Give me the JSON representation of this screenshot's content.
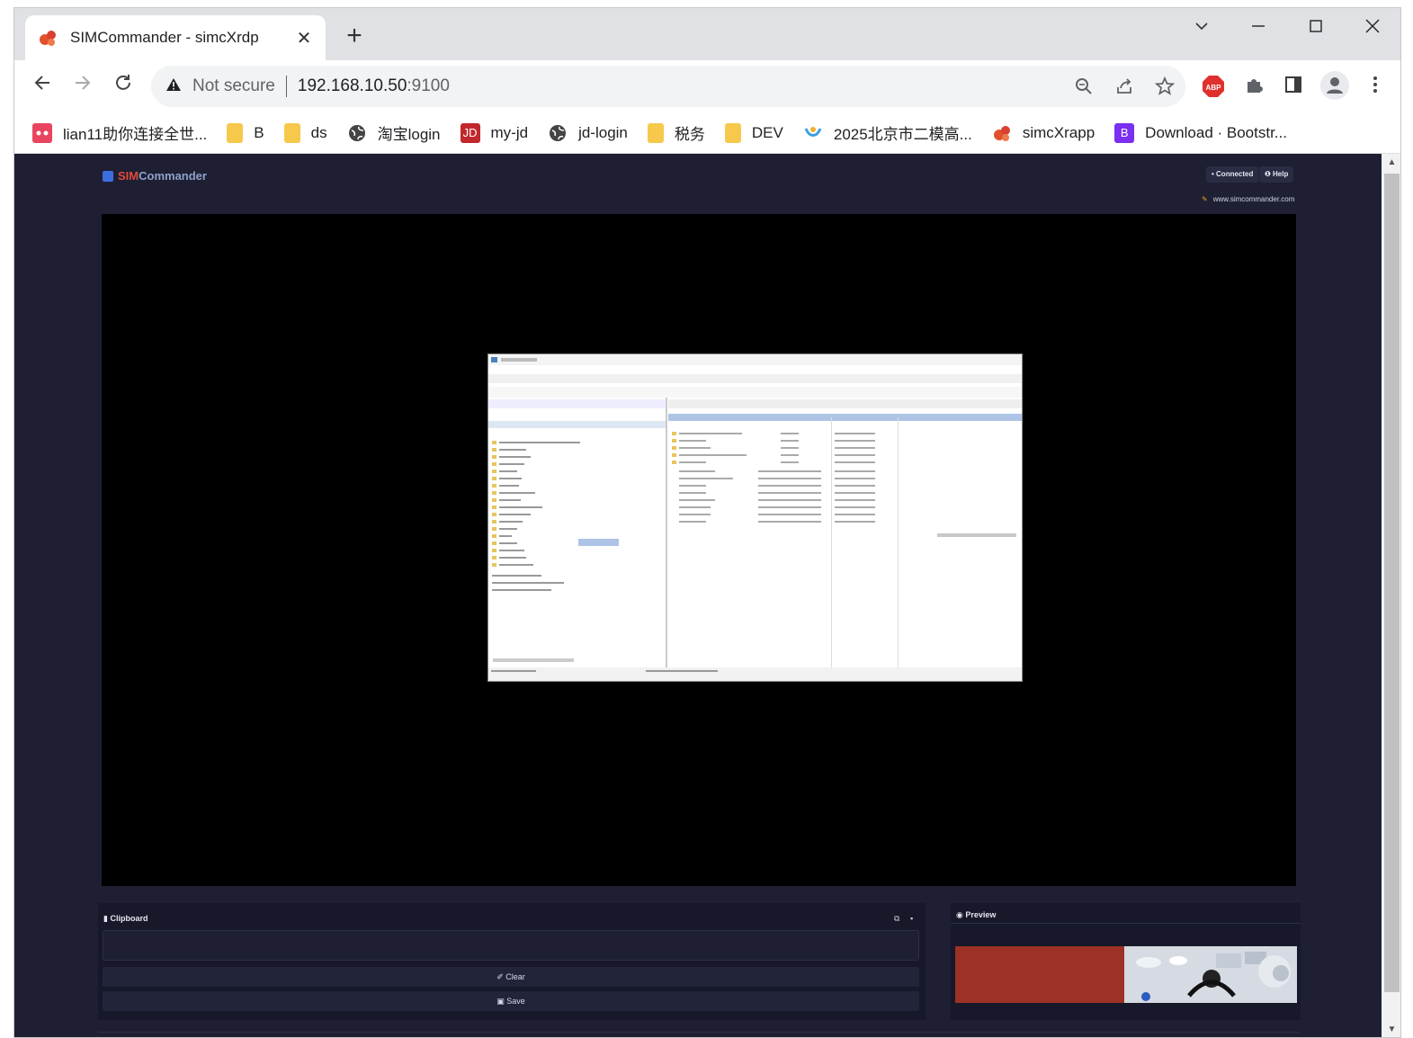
{
  "browser": {
    "tab_title": "SIMCommander - simcXrdp",
    "tab_close": "✕",
    "new_tab": "+",
    "security_label": "Not secure",
    "url_host": "192.168.10.50",
    "url_port": ":9100"
  },
  "bookmarks": [
    {
      "label": "lian11助你连接全世...",
      "icon": "dots-icon",
      "color": "#e94460"
    },
    {
      "label": "B",
      "icon": "folder-icon"
    },
    {
      "label": "ds",
      "icon": "folder-icon"
    },
    {
      "label": "淘宝login",
      "icon": "globe-icon"
    },
    {
      "label": "my-jd",
      "icon": "jd-icon",
      "color": "#c0282d",
      "glyph": "JD"
    },
    {
      "label": "jd-login",
      "icon": "globe-icon"
    },
    {
      "label": "税务",
      "icon": "folder-icon"
    },
    {
      "label": "DEV",
      "icon": "folder-icon"
    },
    {
      "label": "2025北京市二模高...",
      "icon": "app-icon"
    },
    {
      "label": "simcXrapp",
      "icon": "simc-icon"
    },
    {
      "label": "Download · Bootstr...",
      "icon": "bootstrap-icon",
      "color": "#7b2ff0",
      "glyph": "B"
    }
  ],
  "app": {
    "brand_part1": "SIM",
    "brand_part2": "Commander",
    "status_connected": "• Connected",
    "help": "❶ Help",
    "website": "www.simcommander.com",
    "clipboard_header": "Clipboard",
    "clear_label": "Clear",
    "save_label": "Save",
    "preview_header": "Preview"
  },
  "colors": {
    "page_bg": "#1e1f33",
    "accent_red": "#e04a3a",
    "preview_red": "#9e3125"
  }
}
